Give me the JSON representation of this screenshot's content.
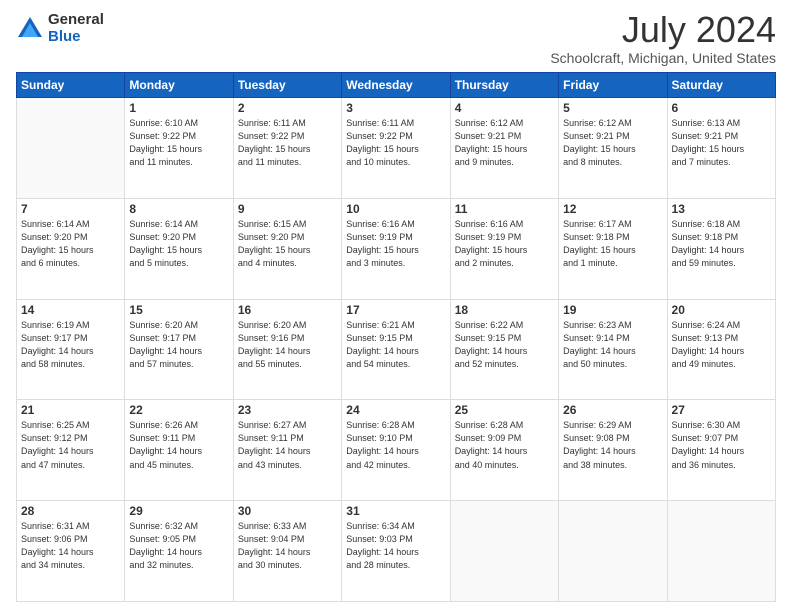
{
  "logo": {
    "general": "General",
    "blue": "Blue"
  },
  "title": "July 2024",
  "location": "Schoolcraft, Michigan, United States",
  "days_of_week": [
    "Sunday",
    "Monday",
    "Tuesday",
    "Wednesday",
    "Thursday",
    "Friday",
    "Saturday"
  ],
  "weeks": [
    [
      {
        "day": "",
        "sunrise": "",
        "sunset": "",
        "daylight": "",
        "empty": true
      },
      {
        "day": "1",
        "sunrise": "6:10 AM",
        "sunset": "9:22 PM",
        "daylight": "15 hours and 11 minutes."
      },
      {
        "day": "2",
        "sunrise": "6:11 AM",
        "sunset": "9:22 PM",
        "daylight": "15 hours and 11 minutes."
      },
      {
        "day": "3",
        "sunrise": "6:11 AM",
        "sunset": "9:22 PM",
        "daylight": "15 hours and 10 minutes."
      },
      {
        "day": "4",
        "sunrise": "6:12 AM",
        "sunset": "9:21 PM",
        "daylight": "15 hours and 9 minutes."
      },
      {
        "day": "5",
        "sunrise": "6:12 AM",
        "sunset": "9:21 PM",
        "daylight": "15 hours and 8 minutes."
      },
      {
        "day": "6",
        "sunrise": "6:13 AM",
        "sunset": "9:21 PM",
        "daylight": "15 hours and 7 minutes."
      }
    ],
    [
      {
        "day": "7",
        "sunrise": "6:14 AM",
        "sunset": "9:20 PM",
        "daylight": "15 hours and 6 minutes."
      },
      {
        "day": "8",
        "sunrise": "6:14 AM",
        "sunset": "9:20 PM",
        "daylight": "15 hours and 5 minutes."
      },
      {
        "day": "9",
        "sunrise": "6:15 AM",
        "sunset": "9:20 PM",
        "daylight": "15 hours and 4 minutes."
      },
      {
        "day": "10",
        "sunrise": "6:16 AM",
        "sunset": "9:19 PM",
        "daylight": "15 hours and 3 minutes."
      },
      {
        "day": "11",
        "sunrise": "6:16 AM",
        "sunset": "9:19 PM",
        "daylight": "15 hours and 2 minutes."
      },
      {
        "day": "12",
        "sunrise": "6:17 AM",
        "sunset": "9:18 PM",
        "daylight": "15 hours and 1 minute."
      },
      {
        "day": "13",
        "sunrise": "6:18 AM",
        "sunset": "9:18 PM",
        "daylight": "14 hours and 59 minutes."
      }
    ],
    [
      {
        "day": "14",
        "sunrise": "6:19 AM",
        "sunset": "9:17 PM",
        "daylight": "14 hours and 58 minutes."
      },
      {
        "day": "15",
        "sunrise": "6:20 AM",
        "sunset": "9:17 PM",
        "daylight": "14 hours and 57 minutes."
      },
      {
        "day": "16",
        "sunrise": "6:20 AM",
        "sunset": "9:16 PM",
        "daylight": "14 hours and 55 minutes."
      },
      {
        "day": "17",
        "sunrise": "6:21 AM",
        "sunset": "9:15 PM",
        "daylight": "14 hours and 54 minutes."
      },
      {
        "day": "18",
        "sunrise": "6:22 AM",
        "sunset": "9:15 PM",
        "daylight": "14 hours and 52 minutes."
      },
      {
        "day": "19",
        "sunrise": "6:23 AM",
        "sunset": "9:14 PM",
        "daylight": "14 hours and 50 minutes."
      },
      {
        "day": "20",
        "sunrise": "6:24 AM",
        "sunset": "9:13 PM",
        "daylight": "14 hours and 49 minutes."
      }
    ],
    [
      {
        "day": "21",
        "sunrise": "6:25 AM",
        "sunset": "9:12 PM",
        "daylight": "14 hours and 47 minutes."
      },
      {
        "day": "22",
        "sunrise": "6:26 AM",
        "sunset": "9:11 PM",
        "daylight": "14 hours and 45 minutes."
      },
      {
        "day": "23",
        "sunrise": "6:27 AM",
        "sunset": "9:11 PM",
        "daylight": "14 hours and 43 minutes."
      },
      {
        "day": "24",
        "sunrise": "6:28 AM",
        "sunset": "9:10 PM",
        "daylight": "14 hours and 42 minutes."
      },
      {
        "day": "25",
        "sunrise": "6:28 AM",
        "sunset": "9:09 PM",
        "daylight": "14 hours and 40 minutes."
      },
      {
        "day": "26",
        "sunrise": "6:29 AM",
        "sunset": "9:08 PM",
        "daylight": "14 hours and 38 minutes."
      },
      {
        "day": "27",
        "sunrise": "6:30 AM",
        "sunset": "9:07 PM",
        "daylight": "14 hours and 36 minutes."
      }
    ],
    [
      {
        "day": "28",
        "sunrise": "6:31 AM",
        "sunset": "9:06 PM",
        "daylight": "14 hours and 34 minutes."
      },
      {
        "day": "29",
        "sunrise": "6:32 AM",
        "sunset": "9:05 PM",
        "daylight": "14 hours and 32 minutes."
      },
      {
        "day": "30",
        "sunrise": "6:33 AM",
        "sunset": "9:04 PM",
        "daylight": "14 hours and 30 minutes."
      },
      {
        "day": "31",
        "sunrise": "6:34 AM",
        "sunset": "9:03 PM",
        "daylight": "14 hours and 28 minutes."
      },
      {
        "day": "",
        "sunrise": "",
        "sunset": "",
        "daylight": "",
        "empty": true
      },
      {
        "day": "",
        "sunrise": "",
        "sunset": "",
        "daylight": "",
        "empty": true
      },
      {
        "day": "",
        "sunrise": "",
        "sunset": "",
        "daylight": "",
        "empty": true
      }
    ]
  ]
}
